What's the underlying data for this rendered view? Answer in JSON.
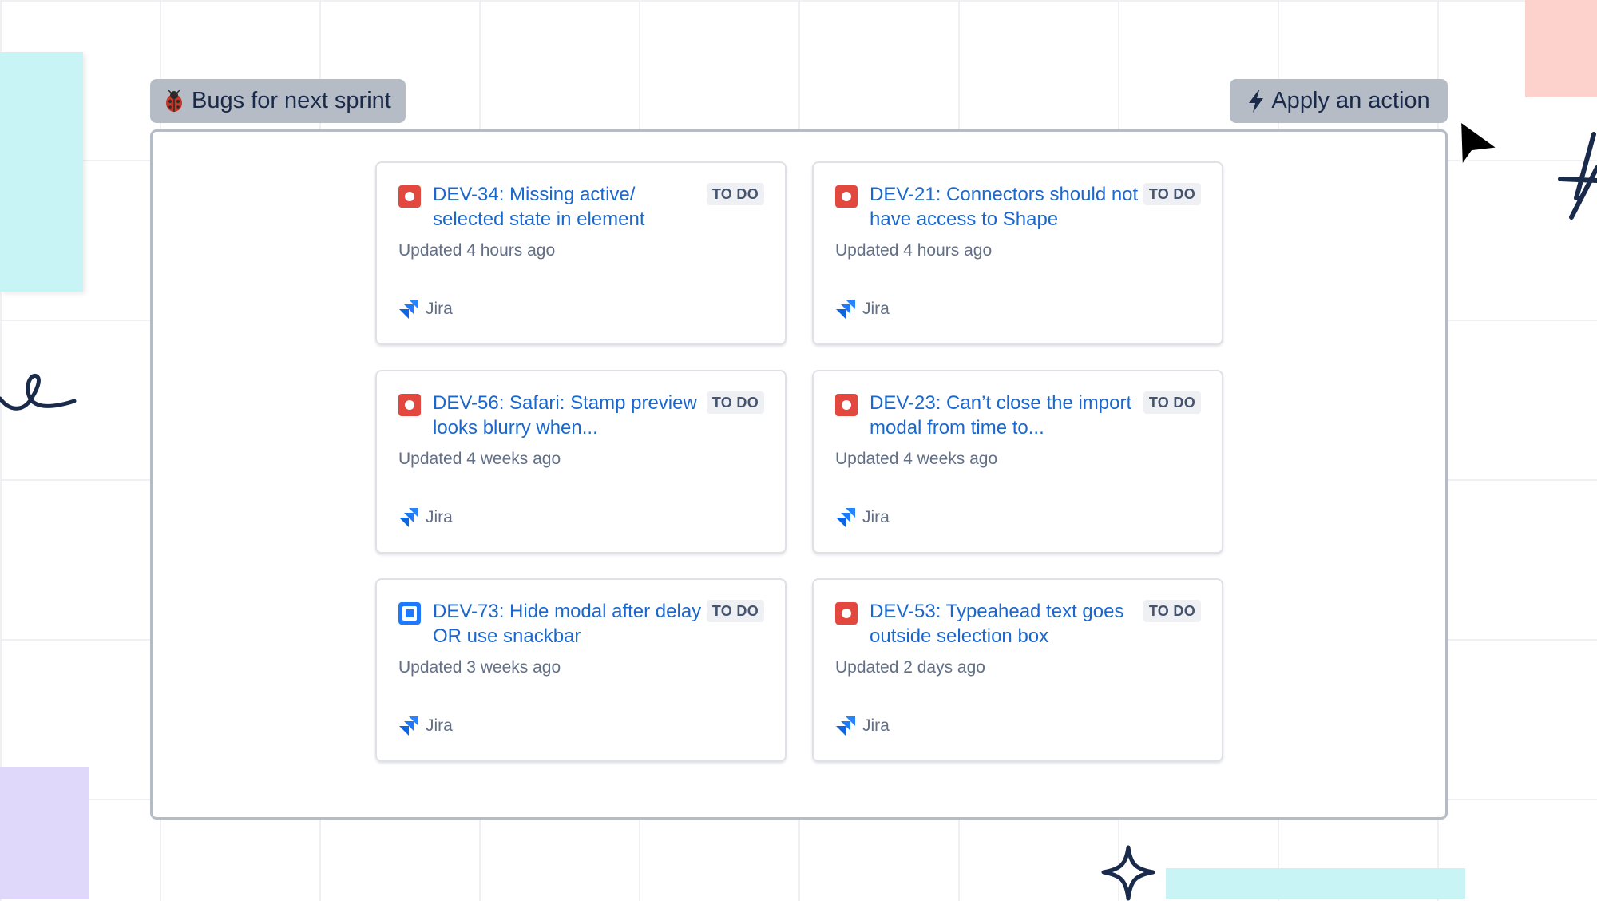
{
  "canvas": {
    "grid_color": "#eef0f3",
    "sticky_colors": [
      "#c8f4f6",
      "#fdd1cc",
      "#e0d8fb"
    ]
  },
  "frame": {
    "title_icon": "ladybug-icon",
    "title": "Bugs for next sprint",
    "action_icon": "lightning-bolt-icon",
    "action_label": "Apply an action"
  },
  "cards": [
    {
      "type_icon": "bug-issue-icon",
      "type_color": "#e2483d",
      "title": "DEV-34: Missing active/ selected state in element",
      "status": "TO DO",
      "updated": "Updated 4 hours ago",
      "source_icon": "jira-icon",
      "source": "Jira"
    },
    {
      "type_icon": "bug-issue-icon",
      "type_color": "#e2483d",
      "title": "DEV-21: Connectors should not have access to Shape",
      "status": "TO DO",
      "updated": "Updated 4 hours ago",
      "source_icon": "jira-icon",
      "source": "Jira"
    },
    {
      "type_icon": "bug-issue-icon",
      "type_color": "#e2483d",
      "title": "DEV-56: Safari: Stamp preview looks blurry when...",
      "status": "TO DO",
      "updated": "Updated 4 weeks ago",
      "source_icon": "jira-icon",
      "source": "Jira"
    },
    {
      "type_icon": "bug-issue-icon",
      "type_color": "#e2483d",
      "title": "DEV-23: Can’t close the import modal from time to...",
      "status": "TO DO",
      "updated": "Updated 4 weeks ago",
      "source_icon": "jira-icon",
      "source": "Jira"
    },
    {
      "type_icon": "task-issue-icon",
      "type_color": "#1d7afc",
      "title": "DEV-73: Hide modal after delay OR use snackbar",
      "status": "TO DO",
      "updated": "Updated 3 weeks ago",
      "source_icon": "jira-icon",
      "source": "Jira"
    },
    {
      "type_icon": "bug-issue-icon",
      "type_color": "#e2483d",
      "title": "DEV-53: Typeahead text goes outside selection box",
      "status": "TO DO",
      "updated": "Updated 2 days ago",
      "source_icon": "jira-icon",
      "source": "Jira"
    }
  ],
  "colors": {
    "link": "#1a68cf",
    "header_chip": "#b6bcc6",
    "status_bg": "#eff0f3",
    "muted_text": "#626f86",
    "ink": "#1a2a4a"
  }
}
